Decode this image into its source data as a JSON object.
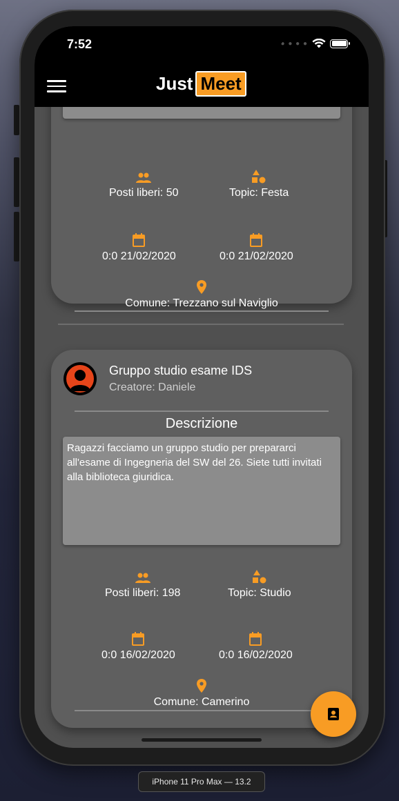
{
  "status_bar": {
    "time": "7:52"
  },
  "app_bar": {
    "logo_just": "Just",
    "logo_meet": "Meet",
    "brand_color": "#f89c24"
  },
  "events": [
    {
      "posti_liberi": "Posti liberi: 50",
      "topic": "Topic: Festa",
      "data_inizio": "0:0 21/02/2020",
      "data_fine": "0:0 21/02/2020",
      "comune": "Comune: Trezzano sul Naviglio"
    },
    {
      "title": "Gruppo studio esame IDS",
      "creator": "Creatore: Daniele",
      "description_label": "Descrizione",
      "description": "Ragazzi facciamo un gruppo studio per prepararci all'esame di Ingegneria del SW del 26. Siete tutti invitati alla biblioteca giuridica.",
      "posti_liberi": "Posti liberi: 198",
      "topic": "Topic: Studio",
      "data_inizio": "0:0 16/02/2020",
      "data_fine": "0:0 16/02/2020",
      "comune": "Comune: Camerino"
    }
  ],
  "simulator_label": "iPhone 11 Pro Max — 13.2",
  "icons": {
    "menu": "hamburger-menu-icon",
    "people": "people-icon",
    "topic": "category-icon",
    "calendar": "calendar-icon",
    "location": "location-pin-icon",
    "fab": "contact-card-icon"
  }
}
